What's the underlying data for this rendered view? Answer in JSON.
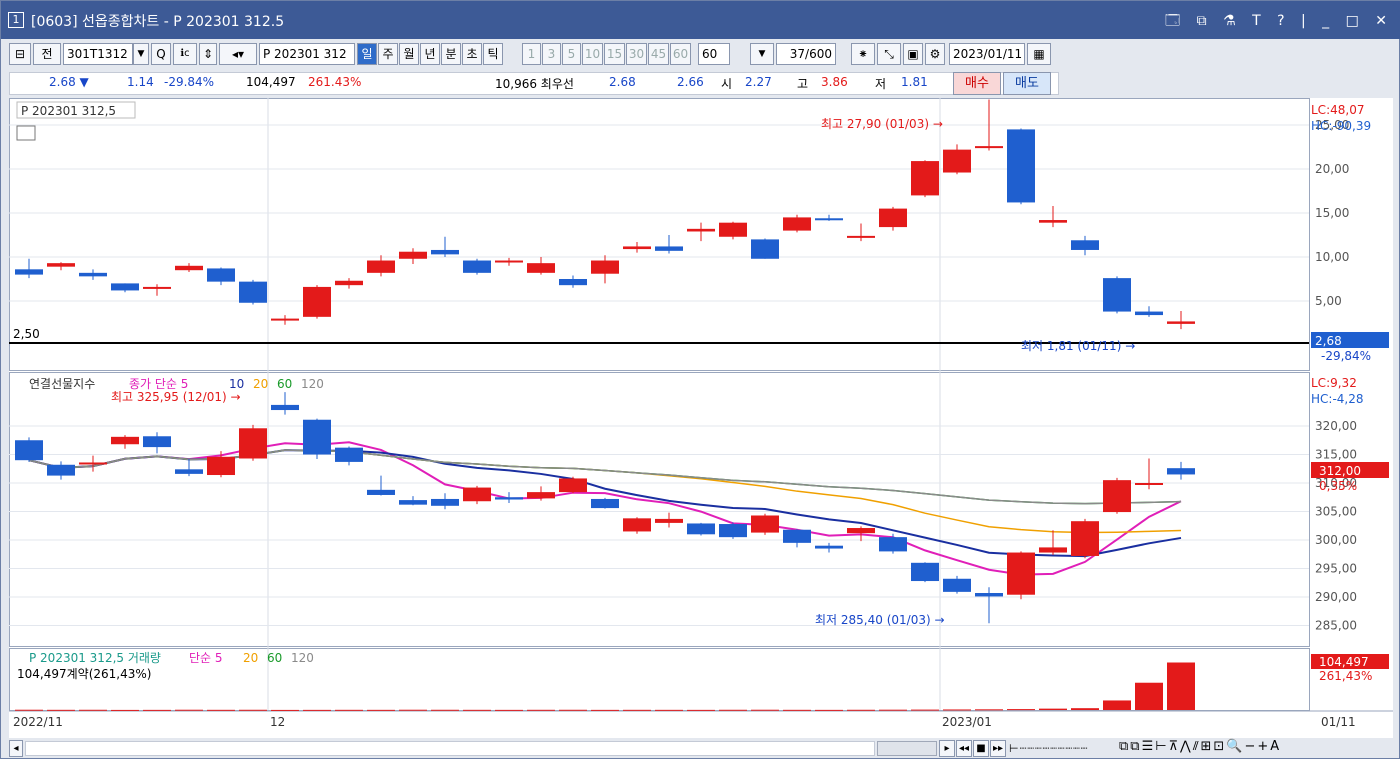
{
  "window": {
    "num": "1",
    "title": "[0603] 선옵종합차트 - P 202301 312.5",
    "controls": "🗔 ⧉ ⚗ T ? | _ □ ✕"
  },
  "toolbar": {
    "tab_jeon": "전",
    "code": "301T1312",
    "dropdown": "▼",
    "search": "Q",
    "arrows": "⇕",
    "prod": "P 202301 312",
    "periods": [
      "일",
      "주",
      "월",
      "년",
      "분",
      "초",
      "틱"
    ],
    "ticks": [
      "1",
      "3",
      "5",
      "10",
      "15",
      "30",
      "45",
      "60"
    ],
    "tick_sel": "60",
    "count": "37/600",
    "date": "2023/01/11"
  },
  "quote": {
    "price": "2.68 ▼",
    "change": "1.14",
    "pct": "-29.84%",
    "volume": "104,497",
    "vol_pct": "261.43%",
    "best_label": "10,966 최우선",
    "ask": "2.68",
    "bid": "2.66",
    "open_label": "시",
    "open": "2.27",
    "high_label": "고",
    "high": "3.86",
    "low_label": "저",
    "low": "1.81",
    "buy": "매수",
    "sell": "매도"
  },
  "panels": {
    "price": {
      "title": "P 202301 312,5",
      "lc": "LC:48,07",
      "hc": "HC:-90,39",
      "line_label": "2,50",
      "max_note": "최고 27,90 (01/03) →",
      "min_note": "최저 1,81 (01/11) →",
      "cur": "2,68",
      "cur_pct": "-29,84%"
    },
    "index": {
      "title": "연결선물지수",
      "ma_label": "종가 단순 5",
      "mas": [
        "10",
        "20",
        "60",
        "120"
      ],
      "lc": "LC:9,32",
      "hc": "HC:-4,28",
      "max_note": "최고 325,95 (12/01) →",
      "min_note": "최저 285,40 (01/03) →",
      "cur": "312,00",
      "cur_pct": "0,35%"
    },
    "volume": {
      "title": "P 202301 312,5 거래량",
      "ma_label": "단순 5",
      "mas": [
        "20",
        "60",
        "120"
      ],
      "sub": "104,497계약(261,43%)",
      "cur": "104,497",
      "cur_pct": "261,43%"
    }
  },
  "xaxis": {
    "labels": [
      "2022/11",
      "12",
      "2023/01"
    ],
    "right": "01/11"
  },
  "colors": {
    "up": "#e31a1a",
    "down": "#1f5fcf",
    "ma5": "#e01fb8",
    "ma10": "#1a2fa0",
    "ma20": "#f0a000",
    "ma60": "#1a9a2a",
    "ma120": "#8a8a8a"
  },
  "chart_data": [
    {
      "type": "candlestick",
      "title": "P 202301 312,5",
      "yticks": [
        "25,00",
        "20,00",
        "15,00",
        "10,00",
        "5,00"
      ],
      "ohlc": [
        [
          8.6,
          9.8,
          7.6,
          8.0
        ],
        [
          8.9,
          9.4,
          8.5,
          9.3
        ],
        [
          8.2,
          8.6,
          7.4,
          7.8
        ],
        [
          7.0,
          7.0,
          6.0,
          6.2
        ],
        [
          6.4,
          6.9,
          5.6,
          6.6
        ],
        [
          8.5,
          9.3,
          8.3,
          9.0
        ],
        [
          8.7,
          8.8,
          6.8,
          7.2
        ],
        [
          7.2,
          7.4,
          4.6,
          4.8
        ],
        [
          2.8,
          3.4,
          2.3,
          3.0
        ],
        [
          3.2,
          6.8,
          3.0,
          6.6
        ],
        [
          6.8,
          7.6,
          6.4,
          7.3
        ],
        [
          8.2,
          10.2,
          7.8,
          9.6
        ],
        [
          9.8,
          11.0,
          9.2,
          10.6
        ],
        [
          10.8,
          12.3,
          10.0,
          10.3
        ],
        [
          9.6,
          9.8,
          8.0,
          8.2
        ],
        [
          9.4,
          9.9,
          9.0,
          9.6
        ],
        [
          8.2,
          10.0,
          8.0,
          9.3
        ],
        [
          7.5,
          7.9,
          6.5,
          6.8
        ],
        [
          8.1,
          10.2,
          7.0,
          9.6
        ],
        [
          10.9,
          11.7,
          10.5,
          11.2
        ],
        [
          11.2,
          12.5,
          10.4,
          10.7
        ],
        [
          12.9,
          13.9,
          11.8,
          13.2
        ],
        [
          12.3,
          14.0,
          12.0,
          13.9
        ],
        [
          12.0,
          12.1,
          9.8,
          9.8
        ],
        [
          13.0,
          14.8,
          12.8,
          14.5
        ],
        [
          14.4,
          14.8,
          14.1,
          14.3
        ],
        [
          12.2,
          13.8,
          11.8,
          12.4
        ],
        [
          13.4,
          15.7,
          13.0,
          15.5
        ],
        [
          17.0,
          21.0,
          16.8,
          20.9
        ],
        [
          19.6,
          22.8,
          19.4,
          22.2
        ],
        [
          22.4,
          27.9,
          22.1,
          22.6
        ],
        [
          24.5,
          24.6,
          16.0,
          16.2
        ],
        [
          13.9,
          15.8,
          13.4,
          14.2
        ],
        [
          11.9,
          12.4,
          10.2,
          10.8
        ],
        [
          7.6,
          7.8,
          3.6,
          3.8
        ],
        [
          3.8,
          4.4,
          3.2,
          3.4
        ],
        [
          2.4,
          3.86,
          1.81,
          2.68
        ]
      ]
    },
    {
      "type": "candlestick",
      "title": "연결선물지수",
      "yticks": [
        "320,00",
        "315,00",
        "310,00",
        "305,00",
        "300,00",
        "295,00",
        "290,00",
        "285,00"
      ],
      "ohlc": [
        [
          317.5,
          318.0,
          313.7,
          314.0
        ],
        [
          313.2,
          313.8,
          310.6,
          311.3
        ],
        [
          313.5,
          314.8,
          312.0,
          313.6
        ],
        [
          316.8,
          318.4,
          316.0,
          318.1
        ],
        [
          318.2,
          318.9,
          315.2,
          316.3
        ],
        [
          312.4,
          314.2,
          311.2,
          311.6
        ],
        [
          311.4,
          315.6,
          311.0,
          314.6
        ],
        [
          314.3,
          320.2,
          313.9,
          319.6
        ],
        [
          323.7,
          325.95,
          322.0,
          322.8
        ],
        [
          321.1,
          321.3,
          314.2,
          315.0
        ],
        [
          316.2,
          316.4,
          313.1,
          313.7
        ],
        [
          308.8,
          311.3,
          307.8,
          307.9
        ],
        [
          307.0,
          307.7,
          306.1,
          306.2
        ],
        [
          307.2,
          308.2,
          305.4,
          306.0
        ],
        [
          306.8,
          309.5,
          306.3,
          309.2
        ],
        [
          307.5,
          308.4,
          306.5,
          307.1
        ],
        [
          307.3,
          309.4,
          306.9,
          308.4
        ],
        [
          308.4,
          311.1,
          308.2,
          310.8
        ],
        [
          307.2,
          307.4,
          305.5,
          305.6
        ],
        [
          301.5,
          304.0,
          301.1,
          303.8
        ],
        [
          303.0,
          304.8,
          302.2,
          303.7
        ],
        [
          302.9,
          303.0,
          300.8,
          301.0
        ],
        [
          302.8,
          303.1,
          300.2,
          300.5
        ],
        [
          301.3,
          304.6,
          300.9,
          304.3
        ],
        [
          301.8,
          301.9,
          298.7,
          299.5
        ],
        [
          299.0,
          299.5,
          297.8,
          298.5
        ],
        [
          301.2,
          302.4,
          299.8,
          302.1
        ],
        [
          300.5,
          301.1,
          297.6,
          298.0
        ],
        [
          296.0,
          296.1,
          292.6,
          292.8
        ],
        [
          293.2,
          293.7,
          290.6,
          290.9
        ],
        [
          290.7,
          291.7,
          285.4,
          290.1
        ],
        [
          290.4,
          298.0,
          289.6,
          297.8
        ],
        [
          297.8,
          301.7,
          297.4,
          298.7
        ],
        [
          297.2,
          303.7,
          296.8,
          303.3
        ],
        [
          304.9,
          310.9,
          304.6,
          310.5
        ],
        [
          309.7,
          314.3,
          308.9,
          310.0
        ],
        [
          312.6,
          313.7,
          310.6,
          311.5
        ]
      ]
    },
    {
      "type": "bar",
      "title": "P 202301 312,5 거래량",
      "values": [
        300,
        600,
        400,
        500,
        200,
        300,
        600,
        400,
        500,
        200,
        300,
        400,
        350,
        600,
        500,
        400,
        300,
        450,
        500,
        300,
        400,
        350,
        300,
        500,
        600,
        400,
        300,
        500,
        700,
        900,
        1200,
        1500,
        2000,
        3000,
        4000,
        21000,
        60000,
        104497
      ],
      "ylim": [
        0,
        110000
      ]
    }
  ]
}
